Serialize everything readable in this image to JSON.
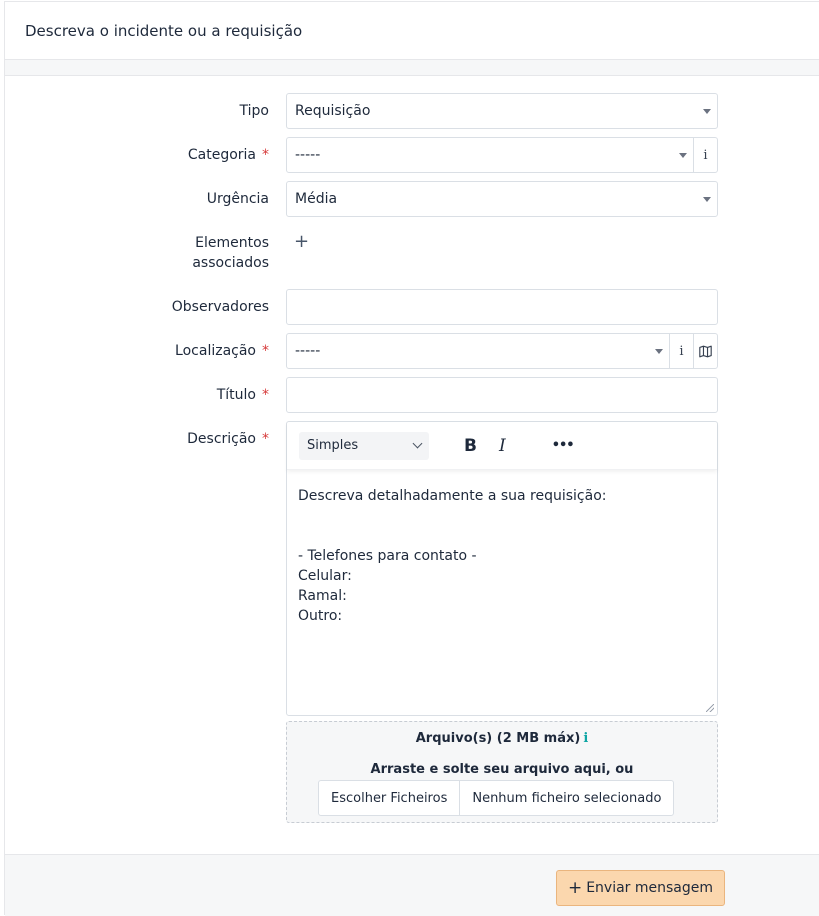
{
  "header": {
    "title": "Descreva o incidente ou a requisição"
  },
  "form": {
    "tipo": {
      "label": "Tipo",
      "value": "Requisição"
    },
    "categoria": {
      "label": "Categoria",
      "value": "-----",
      "info": "i"
    },
    "urgencia": {
      "label": "Urgência",
      "value": "Média"
    },
    "elementos": {
      "label_line1": "Elementos",
      "label_line2": "associados",
      "add": "+"
    },
    "observadores": {
      "label": "Observadores",
      "value": ""
    },
    "localizacao": {
      "label": "Localização",
      "value": "-----",
      "info": "i"
    },
    "titulo": {
      "label": "Título",
      "value": ""
    },
    "descricao": {
      "label": "Descrição",
      "format": "Simples",
      "bold": "B",
      "italic": "I",
      "more": "•••",
      "lines": [
        "Descreva detalhadamente a sua requisição:",
        "",
        "",
        "- Telefones para contato -",
        "Celular:",
        "Ramal:",
        "Outro:"
      ]
    },
    "required_mark": "*"
  },
  "upload": {
    "title": "Arquivo(s) (2 MB máx)",
    "info": "i",
    "drop_text": "Arraste e solte seu arquivo aqui, ou",
    "choose": "Escolher Ficheiros",
    "none": "Nenhum ficheiro selecionado"
  },
  "footer": {
    "submit_plus": "+",
    "submit_label": "Enviar mensagem"
  }
}
